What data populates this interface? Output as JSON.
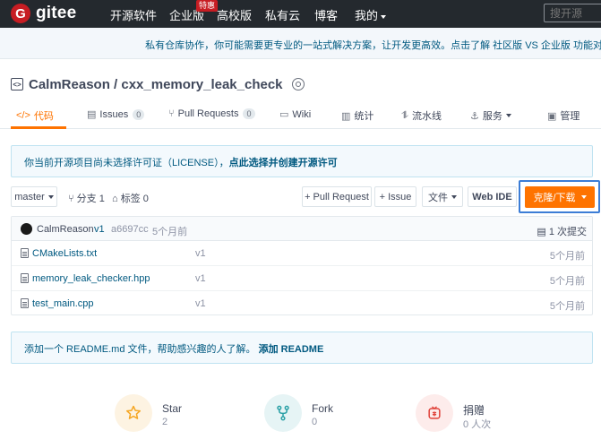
{
  "nav": {
    "logo_mark": "G",
    "logo_text": "gitee",
    "items": [
      "开源软件",
      "企业版",
      "高校版",
      "私有云",
      "博客",
      "我的"
    ],
    "badge": "特惠",
    "search_placeholder": "搜开源"
  },
  "banner": {
    "text": "私有仓库协作，你可能需要更专业的一站式解决方案，让开发更高效。点击了解 社区版 VS 企业版 功能对"
  },
  "repo": {
    "title": "CalmReason / cxx_memory_leak_check"
  },
  "tabs": [
    {
      "icon": "</>",
      "label": "代码"
    },
    {
      "icon": "▤",
      "label": "Issues",
      "count": "0"
    },
    {
      "icon": "⑂",
      "label": "Pull Requests",
      "count": "0"
    },
    {
      "icon": "▭",
      "label": "Wiki"
    },
    {
      "icon": "▥",
      "label": "统计"
    },
    {
      "icon": "⥮",
      "label": "流水线"
    },
    {
      "icon": "⚓",
      "label": "服务"
    },
    {
      "icon": "▣",
      "label": "管理"
    }
  ],
  "license_notice": {
    "text": "你当前开源项目尚未选择许可证（LICENSE），",
    "link": "点此选择并创建开源许可"
  },
  "toolbar": {
    "branch": "master",
    "branches": "分支 1",
    "tags": "标签 0",
    "pull_request": "+ Pull Request",
    "issue": "+ Issue",
    "files": "文件",
    "web_ide": "Web IDE",
    "clone": "克隆/下载"
  },
  "commit": {
    "author": "CalmReason",
    "message": "v1",
    "hash": "a6697cc",
    "time": "5个月前",
    "commits": "1 次提交"
  },
  "files": [
    {
      "name": "CMakeLists.txt",
      "message": "v1",
      "time": "5个月前"
    },
    {
      "name": "memory_leak_checker.hpp",
      "message": "v1",
      "time": "5个月前"
    },
    {
      "name": "test_main.cpp",
      "message": "v1",
      "time": "5个月前"
    }
  ],
  "readme_notice": {
    "text": "添加一个 README.md 文件，帮助感兴趣的人了解。",
    "link": "添加 README"
  },
  "stats": [
    {
      "label": "Star",
      "value": "2"
    },
    {
      "label": "Fork",
      "value": "0"
    },
    {
      "label": "捐赠",
      "value": "0 人次"
    }
  ],
  "colors": {
    "accent": "#fe7300",
    "topnav": "#24292e",
    "link": "#005980",
    "focus": "#3c7dd6"
  }
}
